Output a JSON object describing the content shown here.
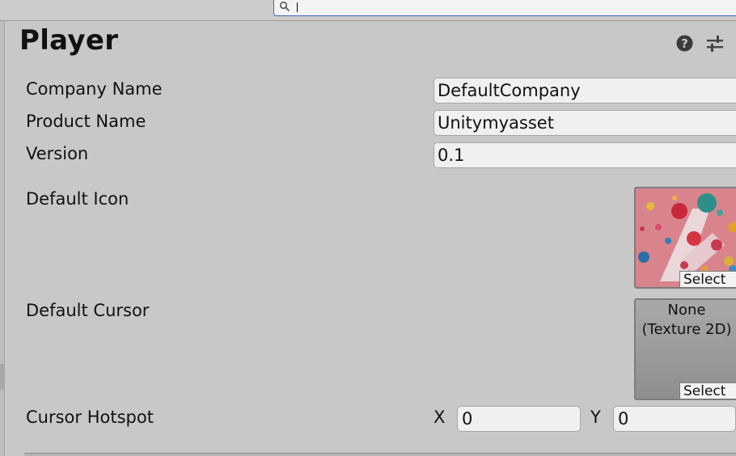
{
  "search": {
    "value": ""
  },
  "panel": {
    "title": "Player"
  },
  "fields": {
    "company_name": {
      "label": "Company Name",
      "value": "DefaultCompany"
    },
    "product_name": {
      "label": "Product Name",
      "value": "Unitymyasset"
    },
    "version": {
      "label": "Version",
      "value": "0.1"
    }
  },
  "default_icon": {
    "label": "Default Icon",
    "select_label": "Select"
  },
  "default_cursor": {
    "label": "Default Cursor",
    "none_line1": "None",
    "none_line2": "(Texture 2D)",
    "select_label": "Select"
  },
  "cursor_hotspot": {
    "label": "Cursor Hotspot",
    "x_label": "X",
    "x_value": "0",
    "y_label": "Y",
    "y_value": "0"
  },
  "icons": {
    "search": "search-icon",
    "help": "help-icon",
    "settings": "settings-sliders-icon"
  },
  "colors": {
    "background": "#c8c8c8",
    "field_bg": "#f0f0f0",
    "focus_border": "#3b6cc0",
    "icon_pink": "#d9848d"
  }
}
